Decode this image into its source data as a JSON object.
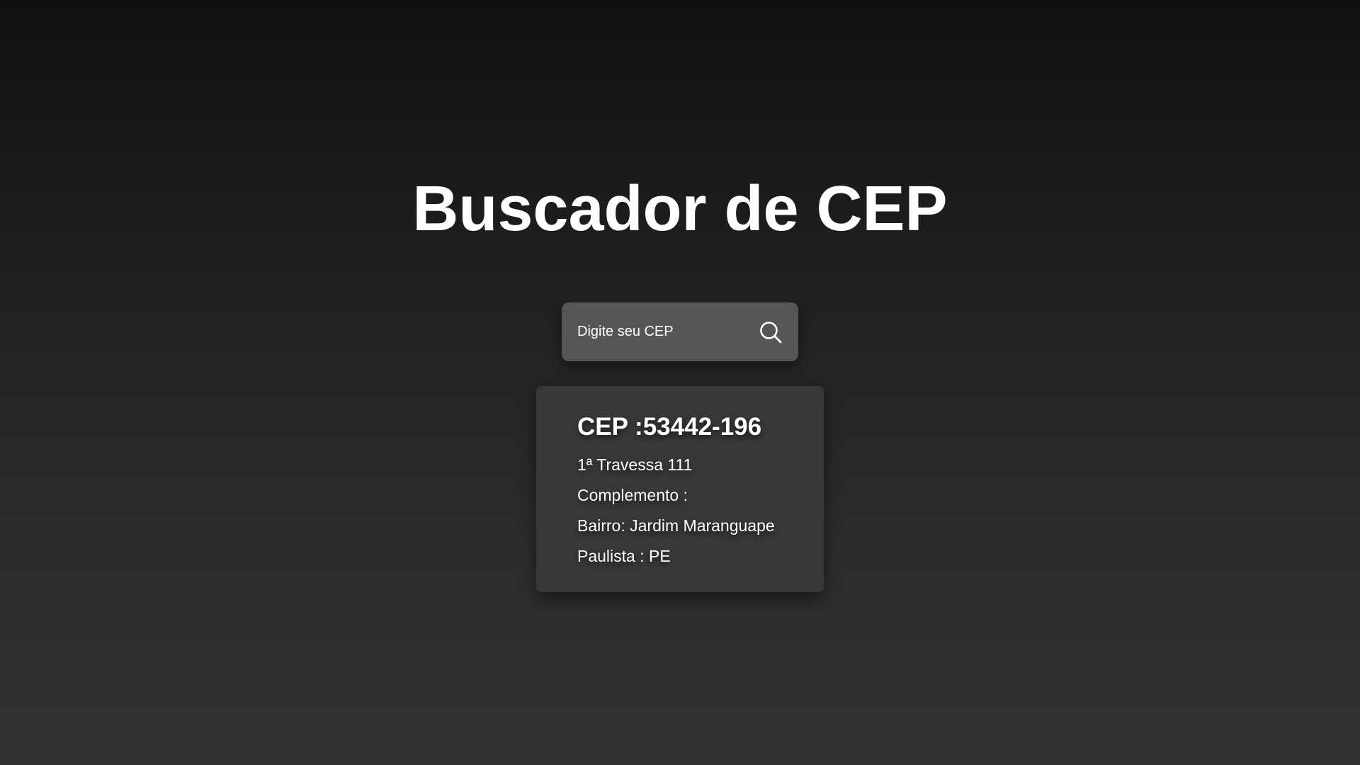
{
  "header": {
    "title": "Buscador de CEP"
  },
  "search": {
    "placeholder": "Digite seu CEP",
    "value": "",
    "button_icon": "search-icon"
  },
  "result": {
    "cep": "CEP :53442-196",
    "logradouro": "1ª Travessa 111",
    "complemento": "Complemento :",
    "bairro": "Bairro: Jardim Maranguape",
    "cidade_uf": "Paulista : PE"
  },
  "colors": {
    "background_top": "#111111",
    "background_bottom": "#333333",
    "search_box": "#565656",
    "card": "#383838",
    "text": "#ffffff"
  }
}
